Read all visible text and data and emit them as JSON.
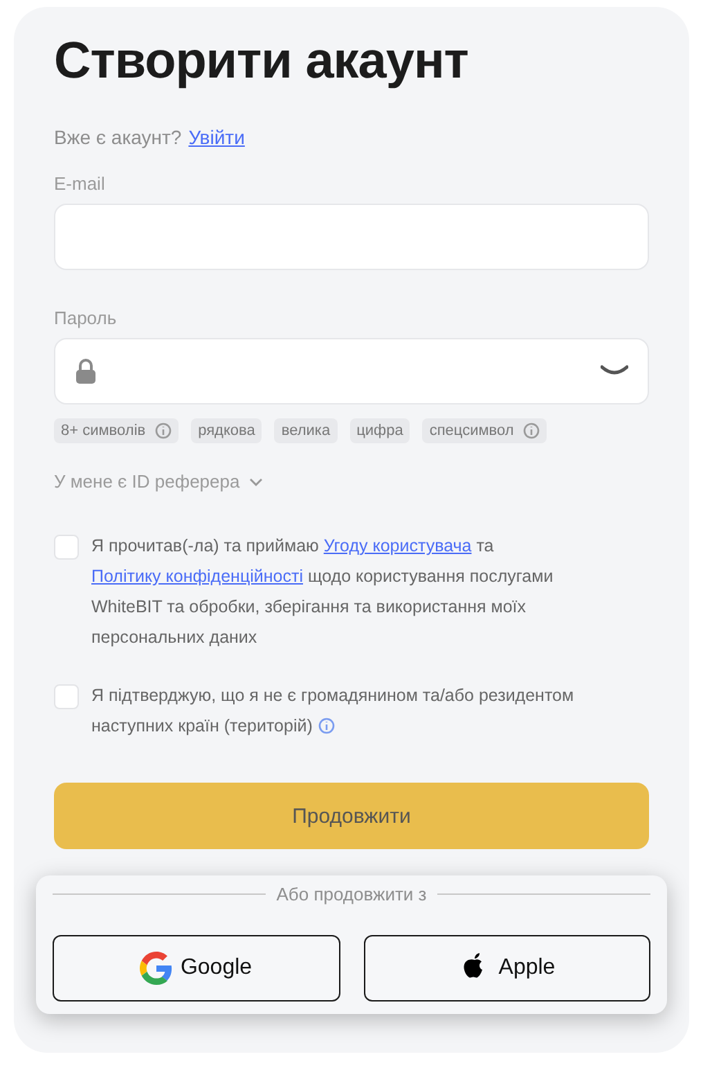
{
  "title": "Створити акаунт",
  "login_prompt": {
    "text": "Вже є акаунт?",
    "link": "Увійти"
  },
  "email": {
    "label": "E-mail"
  },
  "password": {
    "label": "Пароль"
  },
  "requirements": [
    {
      "label": "8+ символів",
      "info": true
    },
    {
      "label": "рядкова",
      "info": false
    },
    {
      "label": "велика",
      "info": false
    },
    {
      "label": "цифра",
      "info": false
    },
    {
      "label": "спецсимвол",
      "info": true
    }
  ],
  "referrer": {
    "label": "У мене є ID реферера",
    "expanded": false
  },
  "agreements": [
    {
      "checked": false,
      "info": false,
      "parts": [
        {
          "text": "Я прочитав(-ла) та приймаю ",
          "link": false
        },
        {
          "text": "Угоду користувача",
          "link": true
        },
        {
          "text": " та ",
          "link": false
        },
        {
          "text": "Політику конфіденційності",
          "link": true
        },
        {
          "text": " щодо користування послугами WhiteBIT та обробки, зберігання та використання моїх персональних даних",
          "link": false
        }
      ]
    },
    {
      "checked": false,
      "info": true,
      "parts": [
        {
          "text": "Я підтверджую, що я не є громадянином та/або резидентом наступних країн (територій)",
          "link": false
        }
      ]
    }
  ],
  "submit": "Продовжити",
  "social": {
    "divider": "Або продовжити з",
    "buttons": [
      {
        "kind": "google",
        "label": "Google"
      },
      {
        "kind": "apple",
        "label": "Apple"
      }
    ]
  }
}
